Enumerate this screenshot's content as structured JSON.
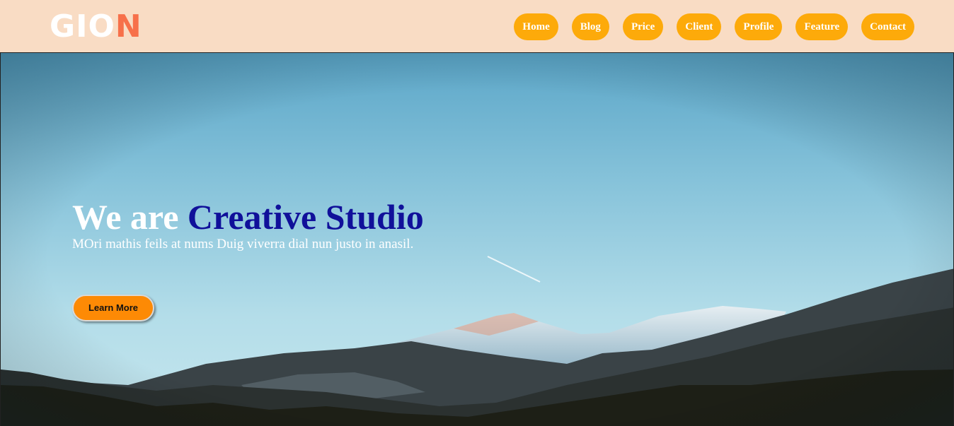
{
  "brand": {
    "logo_part1": "GIO",
    "logo_part2": "N"
  },
  "nav": {
    "items": [
      "Home",
      "Blog",
      "Price",
      "Client",
      "Profile",
      "Feature",
      "Contact"
    ]
  },
  "hero": {
    "title_part1": "We are ",
    "title_part2": "Creative Studio",
    "subtitle": "MOri mathis feils at nums Duig viverra dial nun justo in anasil.",
    "button_label": "Learn More"
  },
  "colors": {
    "nav_bg": "#f9dcc4",
    "nav_button": "#fdaa0a",
    "logo_accent": "#f7704a",
    "title_accent": "#10109a",
    "cta_button": "#fd8a05"
  }
}
